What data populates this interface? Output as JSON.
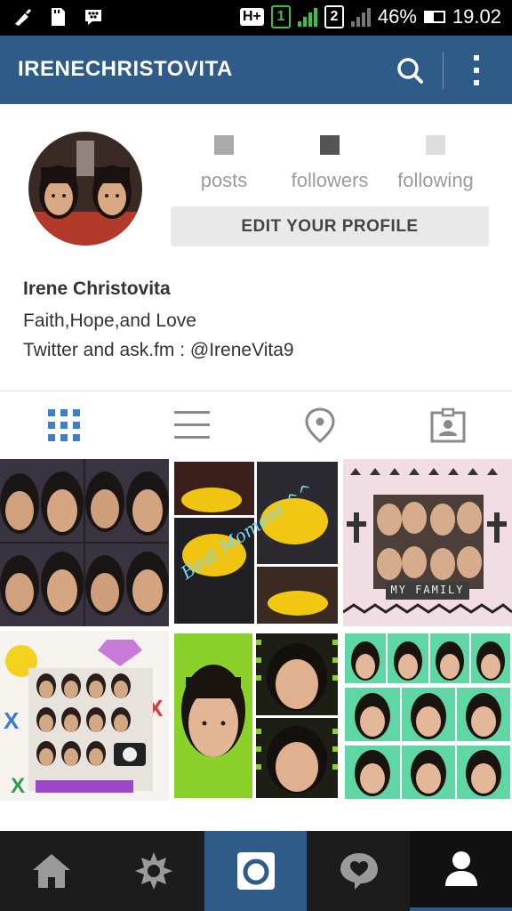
{
  "status_bar": {
    "network_type": "H+",
    "sim1": "1",
    "sim2": "2",
    "battery": "46%",
    "battery_level": 0.46,
    "time": "19.02",
    "icons": [
      "cleaner-icon",
      "sd-card-icon",
      "bbm-icon"
    ]
  },
  "app_bar": {
    "title": "IRENECHRISTOVITA",
    "icons": [
      "search-icon",
      "more-vertical-icon"
    ]
  },
  "profile": {
    "stats": [
      {
        "label": "posts",
        "count_color": "#aaaaaa"
      },
      {
        "label": "followers",
        "count_color": "#555555"
      },
      {
        "label": "following",
        "count_color": "#dddddd"
      }
    ],
    "edit_button": "EDIT YOUR PROFILE",
    "name": "Irene Christovita",
    "bio_line1": "Faith,Hope,and Love",
    "bio_line2": "Twitter and ask.fm : @IreneVita9"
  },
  "tabs": [
    {
      "icon": "grid-view-icon",
      "active": true
    },
    {
      "icon": "list-view-icon",
      "active": false
    },
    {
      "icon": "location-pin-icon",
      "active": false
    },
    {
      "icon": "tagged-photos-icon",
      "active": false
    }
  ],
  "grid": {
    "captions": [
      "Best Moment ^^",
      "MY FAMILY"
    ]
  },
  "bottom_nav": [
    {
      "icon": "home-icon"
    },
    {
      "icon": "explore-icon"
    },
    {
      "icon": "camera-icon"
    },
    {
      "icon": "activity-heart-icon"
    },
    {
      "icon": "profile-icon"
    }
  ],
  "colors": {
    "brand": "#2e5b88",
    "status_bar": "#000000",
    "bottom_nav": "#1c1c1c",
    "active_tab": "#3f7fc4"
  }
}
